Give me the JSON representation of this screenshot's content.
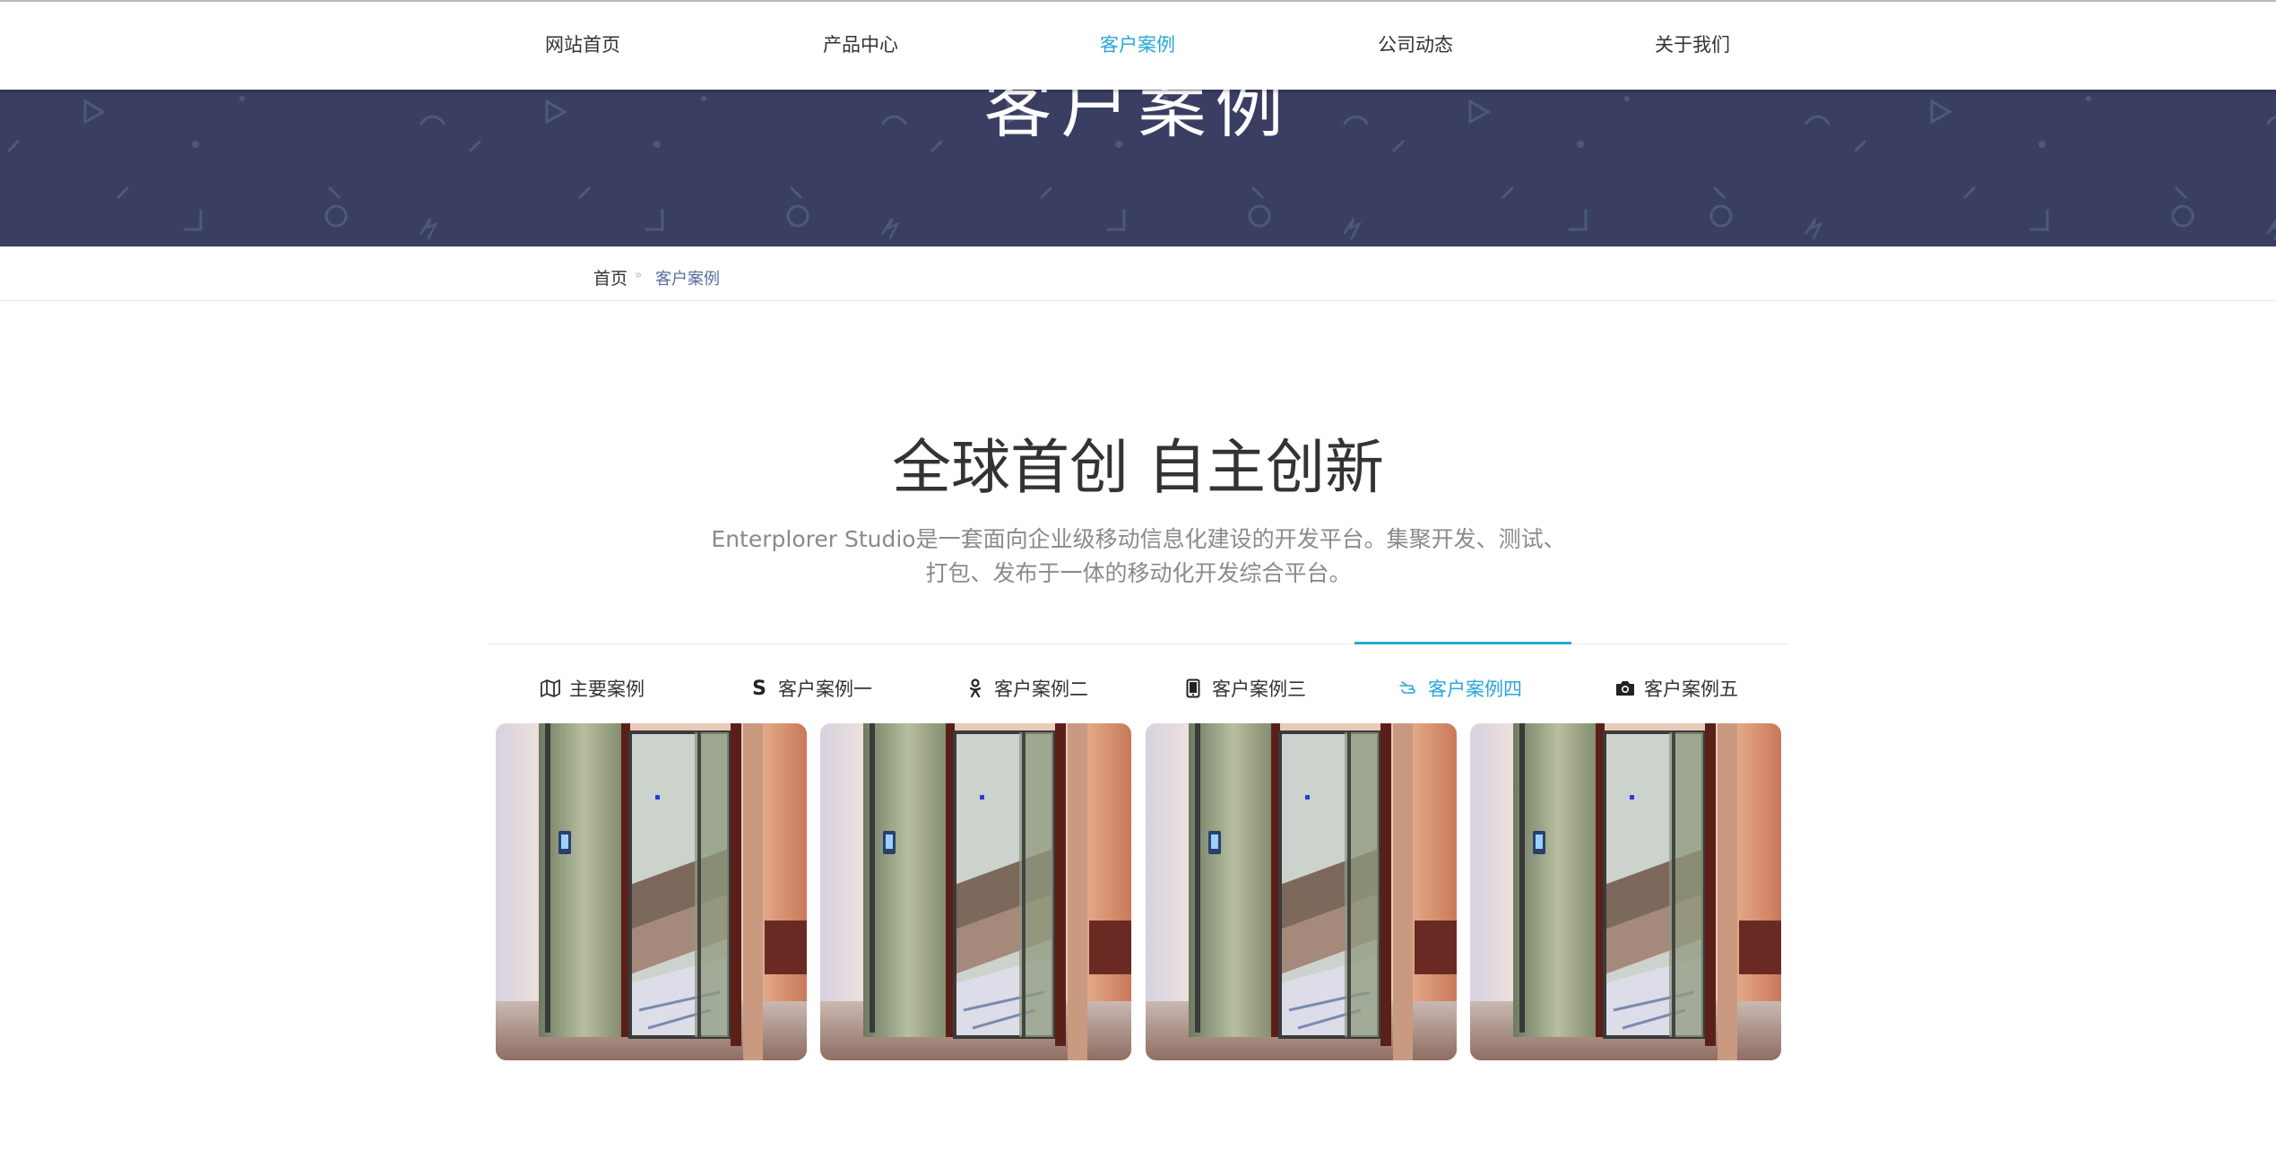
{
  "nav": {
    "items": [
      {
        "label": "网站首页",
        "active": false
      },
      {
        "label": "产品中心",
        "active": false
      },
      {
        "label": "客户案例",
        "active": true
      },
      {
        "label": "公司动态",
        "active": false
      },
      {
        "label": "关于我们",
        "active": false
      }
    ]
  },
  "banner": {
    "title": "客户案例",
    "background": "#3b3e63"
  },
  "breadcrumb": {
    "home": "首页",
    "separator": "»",
    "current": "客户案例"
  },
  "intro": {
    "headline": "全球首创 自主创新",
    "description_line1": "Enterplorer Studio是一套面向企业级移动信息化建设的开发平台。集聚开发、测试、",
    "description_line2": "打包、发布于一体的移动化开发综合平台。"
  },
  "tabs": [
    {
      "label": "主要案例",
      "icon": "map-icon",
      "active": false
    },
    {
      "label": "客户案例一",
      "icon": "skype-icon",
      "active": false
    },
    {
      "label": "客户案例二",
      "icon": "odnoklassniki-icon",
      "active": false
    },
    {
      "label": "客户案例三",
      "icon": "tablet-icon",
      "active": false
    },
    {
      "label": "客户案例四",
      "icon": "hand-pointer-icon",
      "active": true
    },
    {
      "label": "客户案例五",
      "icon": "camera-icon",
      "active": false
    }
  ],
  "gallery": {
    "image_subject": "glass-elevator-photo",
    "count": 4
  },
  "colors": {
    "accent": "#2aa6d8",
    "text": "#333333",
    "muted": "#8a8a8a"
  }
}
